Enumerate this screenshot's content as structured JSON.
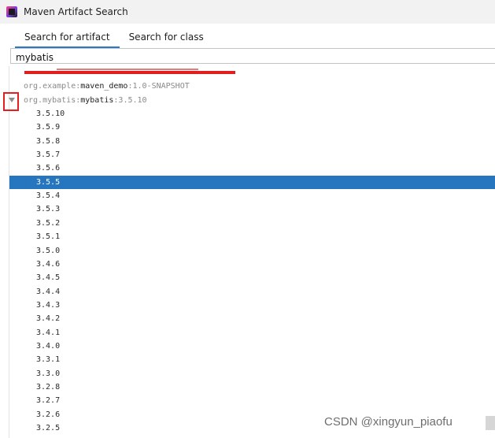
{
  "window": {
    "title": "Maven Artifact Search"
  },
  "tabs": [
    {
      "label": "Search for artifact",
      "active": true
    },
    {
      "label": "Search for class",
      "active": false
    }
  ],
  "search": {
    "value": "mybatis"
  },
  "results": {
    "groups": [
      {
        "group": "org.example:",
        "artifact": "maven_demo",
        "version": ":1.0-SNAPSHOT"
      },
      {
        "group": "org.mybatis:",
        "artifact": "mybatis",
        "version": ":3.5.10"
      }
    ],
    "versions": [
      "3.5.10",
      "3.5.9",
      "3.5.8",
      "3.5.7",
      "3.5.6",
      "3.5.5",
      "3.5.4",
      "3.5.3",
      "3.5.2",
      "3.5.1",
      "3.5.0",
      "3.4.6",
      "3.4.5",
      "3.4.4",
      "3.4.3",
      "3.4.2",
      "3.4.1",
      "3.4.0",
      "3.3.1",
      "3.3.0",
      "3.2.8",
      "3.2.7",
      "3.2.6",
      "3.2.5"
    ],
    "selected_version": "3.5.5"
  },
  "colors": {
    "accent": "#2a79c8",
    "selection": "#2675bf",
    "annotation_red": "#e41f1f"
  },
  "icons": {
    "app": "intellij-idea-icon",
    "expand": "triangle-down-icon"
  },
  "watermark": "CSDN @xingyun_piaofu"
}
